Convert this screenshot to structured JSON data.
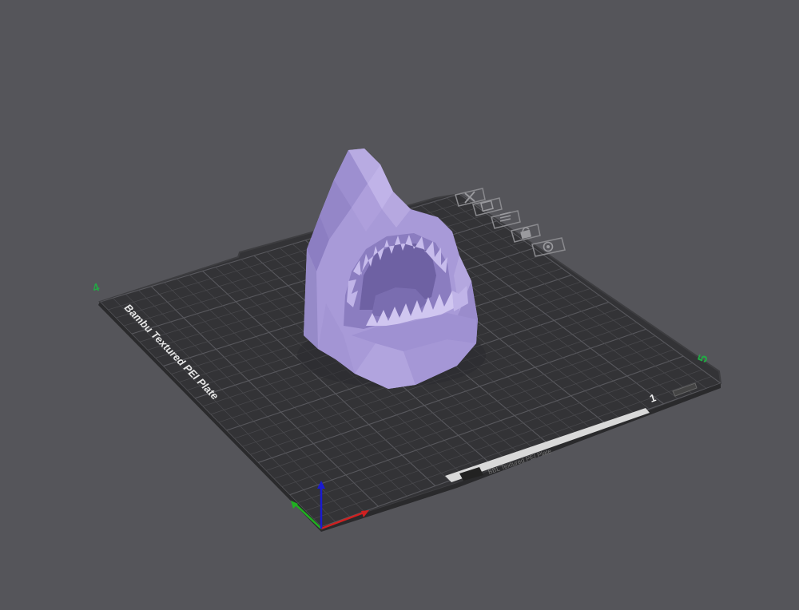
{
  "viewport": {
    "background_color": "#55555a",
    "bed": {
      "name": "Bambu Textured PEI Plate",
      "plate_number": "1",
      "corner_labels": {
        "left": "4",
        "right": "5"
      },
      "label_strip_text": "BBL Textured PEI Plate",
      "plate_color": "#333336",
      "grid_color": "#4a4a4e"
    },
    "model": {
      "name": "shark-head",
      "color": "#a89ad8"
    },
    "plate_toolbar": [
      {
        "name": "delete-plate-icon",
        "icon": "close-x"
      },
      {
        "name": "pick-plate-icon",
        "icon": "image-frame"
      },
      {
        "name": "arrange-plate-icon",
        "icon": "grid-arrange"
      },
      {
        "name": "lock-plate-icon",
        "icon": "lock"
      },
      {
        "name": "plate-settings-icon",
        "icon": "gear"
      }
    ],
    "axes": {
      "x_color": "#d02020",
      "y_color": "#20b020",
      "z_color": "#1a1ad0"
    }
  }
}
